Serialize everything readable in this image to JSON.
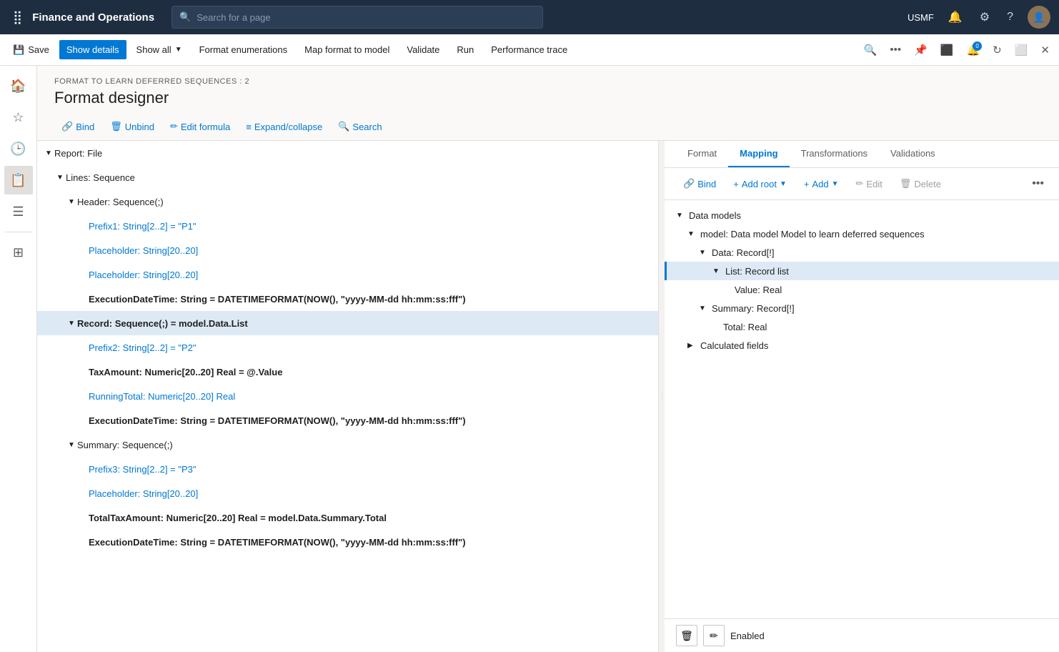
{
  "app": {
    "title": "Finance and Operations",
    "search_placeholder": "Search for a page",
    "user_region": "USMF"
  },
  "toolbar": {
    "save_label": "Save",
    "show_details_label": "Show details",
    "show_all_label": "Show all",
    "format_enumerations_label": "Format enumerations",
    "map_format_label": "Map format to model",
    "validate_label": "Validate",
    "run_label": "Run",
    "performance_trace_label": "Performance trace"
  },
  "page": {
    "breadcrumb": "FORMAT TO LEARN DEFERRED SEQUENCES : 2",
    "title": "Format designer"
  },
  "designer_toolbar": {
    "bind_label": "Bind",
    "unbind_label": "Unbind",
    "edit_formula_label": "Edit formula",
    "expand_collapse_label": "Expand/collapse",
    "search_label": "Search"
  },
  "tabs": {
    "format_label": "Format",
    "mapping_label": "Mapping",
    "transformations_label": "Transformations",
    "validations_label": "Validations"
  },
  "right_toolbar": {
    "bind_label": "Bind",
    "add_root_label": "Add root",
    "add_label": "Add",
    "edit_label": "Edit",
    "delete_label": "Delete"
  },
  "format_tree": [
    {
      "id": "report-file",
      "indent": 0,
      "toggle": "▼",
      "text": "Report: File",
      "bold": false,
      "blue": false,
      "selected": false
    },
    {
      "id": "lines-sequence",
      "indent": 1,
      "toggle": "▼",
      "text": "Lines: Sequence",
      "bold": false,
      "blue": false,
      "selected": false
    },
    {
      "id": "header-sequence",
      "indent": 2,
      "toggle": "▼",
      "text": "Header: Sequence(;)",
      "bold": false,
      "blue": false,
      "selected": false
    },
    {
      "id": "prefix1",
      "indent": 3,
      "toggle": "",
      "text": "Prefix1: String[2..2] = \"P1\"",
      "bold": false,
      "blue": true,
      "selected": false
    },
    {
      "id": "placeholder1",
      "indent": 3,
      "toggle": "",
      "text": "Placeholder: String[20..20]",
      "bold": false,
      "blue": true,
      "selected": false
    },
    {
      "id": "placeholder2",
      "indent": 3,
      "toggle": "",
      "text": "Placeholder: String[20..20]",
      "bold": false,
      "blue": true,
      "selected": false
    },
    {
      "id": "executiondatetime1",
      "indent": 3,
      "toggle": "",
      "text": "ExecutionDateTime: String = DATETIMEFORMAT(NOW(), \"yyyy-MM-dd hh:mm:ss:fff\")",
      "bold": true,
      "blue": false,
      "selected": false
    },
    {
      "id": "record-sequence",
      "indent": 2,
      "toggle": "▼",
      "text": "Record: Sequence(;) = model.Data.List",
      "bold": true,
      "blue": false,
      "selected": true
    },
    {
      "id": "prefix2",
      "indent": 3,
      "toggle": "",
      "text": "Prefix2: String[2..2] = \"P2\"",
      "bold": false,
      "blue": true,
      "selected": false
    },
    {
      "id": "taxamount",
      "indent": 3,
      "toggle": "",
      "text": "TaxAmount: Numeric[20..20] Real = @.Value",
      "bold": true,
      "blue": false,
      "selected": false
    },
    {
      "id": "runningtotal",
      "indent": 3,
      "toggle": "",
      "text": "RunningTotal: Numeric[20..20] Real",
      "bold": false,
      "blue": true,
      "selected": false
    },
    {
      "id": "executiondatetime2",
      "indent": 3,
      "toggle": "",
      "text": "ExecutionDateTime: String = DATETIMEFORMAT(NOW(), \"yyyy-MM-dd hh:mm:ss:fff\")",
      "bold": true,
      "blue": false,
      "selected": false
    },
    {
      "id": "summary-sequence",
      "indent": 2,
      "toggle": "▼",
      "text": "Summary: Sequence(;)",
      "bold": false,
      "blue": false,
      "selected": false
    },
    {
      "id": "prefix3",
      "indent": 3,
      "toggle": "",
      "text": "Prefix3: String[2..2] = \"P3\"",
      "bold": false,
      "blue": true,
      "selected": false
    },
    {
      "id": "placeholder3",
      "indent": 3,
      "toggle": "",
      "text": "Placeholder: String[20..20]",
      "bold": false,
      "blue": true,
      "selected": false
    },
    {
      "id": "totaltaxamount",
      "indent": 3,
      "toggle": "",
      "text": "TotalTaxAmount: Numeric[20..20] Real = model.Data.Summary.Total",
      "bold": true,
      "blue": false,
      "selected": false
    },
    {
      "id": "executiondatetime3",
      "indent": 3,
      "toggle": "",
      "text": "ExecutionDateTime: String = DATETIMEFORMAT(NOW(), \"yyyy-MM-dd hh:mm:ss:fff\")",
      "bold": true,
      "blue": false,
      "selected": false
    }
  ],
  "model_tree": [
    {
      "id": "data-models",
      "indent": 0,
      "toggle": "▼",
      "text": "Data models",
      "selected": false
    },
    {
      "id": "model-deferred",
      "indent": 1,
      "toggle": "▼",
      "text": "model: Data model Model to learn deferred sequences",
      "selected": false
    },
    {
      "id": "data-record",
      "indent": 2,
      "toggle": "▼",
      "text": "Data: Record[!]",
      "selected": false
    },
    {
      "id": "list-record-list",
      "indent": 3,
      "toggle": "▼",
      "text": "List: Record list",
      "selected": true
    },
    {
      "id": "value-real",
      "indent": 4,
      "toggle": "",
      "text": "Value: Real",
      "selected": false
    },
    {
      "id": "summary-record",
      "indent": 2,
      "toggle": "▼",
      "text": "Summary: Record[!]",
      "selected": false
    },
    {
      "id": "total-real",
      "indent": 3,
      "toggle": "",
      "text": "Total: Real",
      "selected": false
    },
    {
      "id": "calculated-fields",
      "indent": 1,
      "toggle": "▶",
      "text": "Calculated fields",
      "selected": false
    }
  ],
  "bottom_bar": {
    "status_label": "Enabled"
  }
}
